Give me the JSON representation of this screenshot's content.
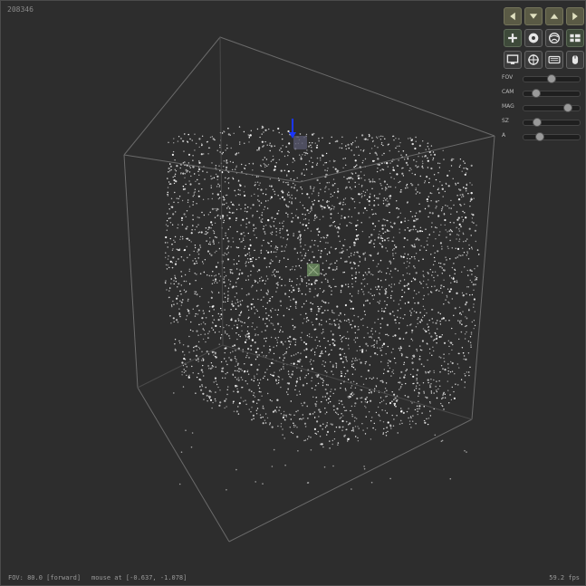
{
  "header": {
    "counter": "208346"
  },
  "status": {
    "fov_text": "FOV: 80.0  [forward]",
    "mouse_text": "mouse at [-0.637, -1.078]",
    "fps_text": "59.2 fps"
  },
  "nav_buttons": [
    "arrow-left-icon",
    "arrow-down-icon",
    "arrow-up-icon",
    "arrow-right-icon"
  ],
  "tool_buttons": [
    "plus-icon",
    "disc-icon",
    "globe-icon",
    "list-icon"
  ],
  "view_buttons": [
    "monitor-icon",
    "crosshair-icon",
    "keyboard-icon",
    "mouse-icon"
  ],
  "sliders": [
    {
      "label": "FOV",
      "value": 0.5
    },
    {
      "label": "CAM",
      "value": 0.18
    },
    {
      "label": "MAG",
      "value": 0.85
    },
    {
      "label": "SZ",
      "value": 0.2
    },
    {
      "label": "A",
      "value": 0.25
    }
  ]
}
